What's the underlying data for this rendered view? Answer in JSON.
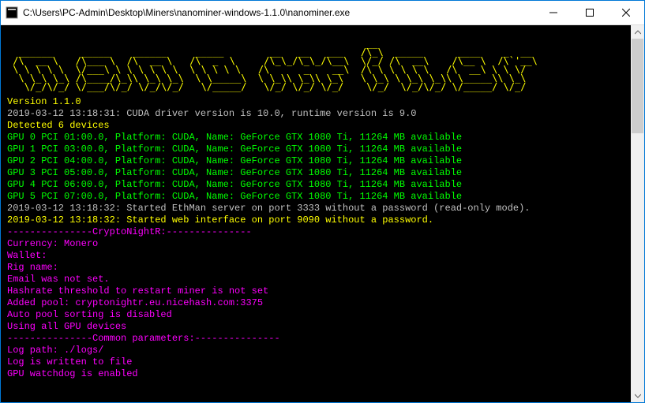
{
  "window": {
    "title": "C:\\Users\\PC-Admin\\Desktop\\Miners\\nanominer-windows-1.1.0\\nanominer.exe"
  },
  "logo_ascii": "                                                               __\n  ______     _____    ______     _____        __   __   ___   /\\_\\  _____      ____    _  __\n /\\  __ \\   /\\___ \\  /\\  __ \\   /\\  _  \\     /\\_\\_/\\_\\_/\\__\\  \\/_/ /\\  __\\    /\\__ \\  /\\`'__\\\n \\ \\ \\ \\ \\  \\/___\\ \\ \\ \\ \\ \\ \\  \\ \\ \\ \\ \\   /\\      _    __\\  /\\ \\ \\ \\ \\ \\   /\\  __\\ \\ \\ \\/\n  \\ \\_\\ \\_\\ /\\____/\\_\\\\ \\_\\ \\_\\  \\ \\_____\\  \\ \\_\\\\ \\_\\\\ \\_\\   \\ \\_\\ \\ \\_\\ \\_\\\\ \\_____\\\\ \\_\\\n   \\/_/\\/_/ \\/___/\\/_/ \\/_/\\/_/   \\/_____/   \\/_/ \\/_/ \\/_/    \\/_/  \\/_/\\/_/ \\/_____/ \\/_/",
  "version_line": "Version 1.1.0",
  "cuda_line": "2019-03-12 13:18:31: CUDA driver version is 10.0, runtime version is 9.0",
  "detected_line": "Detected 6 devices",
  "gpus": [
    "GPU 0 PCI 01:00.0, Platform: CUDA, Name: GeForce GTX 1080 Ti, 11264 MB available",
    "GPU 1 PCI 03:00.0, Platform: CUDA, Name: GeForce GTX 1080 Ti, 11264 MB available",
    "GPU 2 PCI 04:00.0, Platform: CUDA, Name: GeForce GTX 1080 Ti, 11264 MB available",
    "GPU 3 PCI 05:00.0, Platform: CUDA, Name: GeForce GTX 1080 Ti, 11264 MB available",
    "GPU 4 PCI 06:00.0, Platform: CUDA, Name: GeForce GTX 1080 Ti, 11264 MB available",
    "GPU 5 PCI 07:00.0, Platform: CUDA, Name: GeForce GTX 1080 Ti, 11264 MB available"
  ],
  "ethman_line": "2019-03-12 13:18:32: Started EthMan server on port 3333 without a password (read-only mode).",
  "web_line": "2019-03-12 13:18:32: Started web interface on port 9090 without a password.",
  "section1_header": "---------------CryptoNightR:---------------",
  "config_lines": [
    "Currency: Monero",
    "Wallet:",
    "Rig name:",
    "Email was not set.",
    "Hashrate threshold to restart miner is not set",
    "Added pool: cryptonightr.eu.nicehash.com:3375",
    "Auto pool sorting is disabled",
    "Using all GPU devices"
  ],
  "section2_header": "---------------Common parameters:---------------",
  "common_lines": [
    "Log path: ./logs/",
    "Log is written to file",
    "GPU watchdog is enabled"
  ]
}
